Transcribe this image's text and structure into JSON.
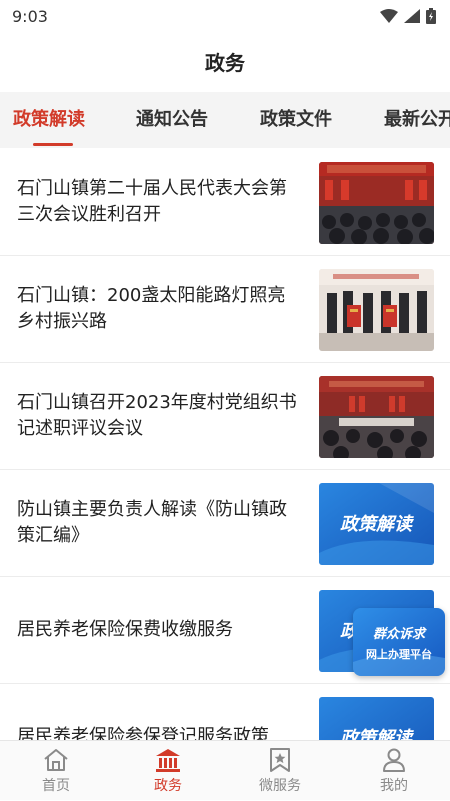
{
  "status_bar": {
    "time": "9:03"
  },
  "header": {
    "title": "政务"
  },
  "tabs": [
    {
      "label": "政策解读",
      "active": true
    },
    {
      "label": "通知公告",
      "active": false
    },
    {
      "label": "政策文件",
      "active": false
    },
    {
      "label": "最新公开",
      "active": false
    }
  ],
  "articles": [
    {
      "title": "石门山镇第二十届人民代表大会第三次会议胜利召开",
      "thumb": "meeting-hall-photo"
    },
    {
      "title": "石门山镇：200盏太阳能路灯照亮乡村振兴路",
      "thumb": "award-ceremony-photo"
    },
    {
      "title": "石门山镇召开2023年度村党组织书记述职评议会议",
      "thumb": "conference-photo"
    },
    {
      "title": "防山镇主要负责人解读《防山镇政策汇编》",
      "thumb": "policy-banner",
      "banner_text": "政策解读"
    },
    {
      "title": "居民养老保险保费收缴服务",
      "thumb": "policy-banner",
      "banner_text": "政策解读"
    },
    {
      "title": "居民养老保险参保登记服务政策",
      "thumb": "policy-banner",
      "banner_text": "政策解读"
    }
  ],
  "floating_button": {
    "line1": "群众诉求",
    "line2": "网上办理平台"
  },
  "bottom_nav": [
    {
      "label": "首页",
      "icon": "home-icon",
      "active": false
    },
    {
      "label": "政务",
      "icon": "government-building-icon",
      "active": true
    },
    {
      "label": "微服务",
      "icon": "star-bookmark-icon",
      "active": false
    },
    {
      "label": "我的",
      "icon": "person-icon",
      "active": false
    }
  ],
  "colors": {
    "accent": "#d23b2a",
    "banner_blue": "#1f6fd1",
    "tab_bg": "#f4f4f4"
  }
}
